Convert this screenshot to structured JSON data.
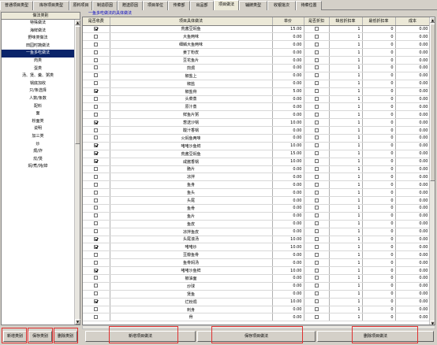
{
  "tabs": [
    {
      "label": "普通项目类型",
      "active": false
    },
    {
      "label": "库存项目类型",
      "active": false
    },
    {
      "label": "原料项目",
      "active": false
    },
    {
      "label": "制造原因",
      "active": false
    },
    {
      "label": "赠送原因",
      "active": false
    },
    {
      "label": "项目单位",
      "active": false
    },
    {
      "label": "传菜部",
      "active": false
    },
    {
      "label": "出品部",
      "active": false
    },
    {
      "label": "项目做法",
      "active": true
    },
    {
      "label": "辅牌类型",
      "active": false
    },
    {
      "label": "收银批次",
      "active": false
    },
    {
      "label": "待菜位置",
      "active": false
    }
  ],
  "left_panel": {
    "header": "做法类别",
    "items": [
      "特殊做法",
      "海鲜做法",
      "野味类做法",
      "田园时蔬做法",
      "一鱼多吃做法",
      "肉类",
      "蛋类",
      "汤、煲、羹、粥类",
      "锅底加收",
      "只/条选择",
      "人数/条数",
      "配料",
      "面",
      "粉面类",
      "说明",
      "加三类",
      "炒",
      "焗/炸",
      "炆/煲",
      "焖/煮/炖/焯"
    ],
    "selected_index": 4
  },
  "right_panel": {
    "caption": "一鱼多吃做法的具体做法",
    "columns": [
      "是否收费",
      "项目具体做法",
      "单价",
      "是否折扣",
      "缺省折扣率",
      "最低折扣率",
      "成本"
    ],
    "rows": [
      {
        "charge": true,
        "name": "荒酱豆焖鱼",
        "price": "15.00",
        "discount": false,
        "default_rate": "1",
        "min_rate": "0",
        "cost": "0.00"
      },
      {
        "charge": false,
        "name": "大鱼两味",
        "price": "0.00",
        "discount": false,
        "default_rate": "1",
        "min_rate": "0",
        "cost": "0.00"
      },
      {
        "charge": false,
        "name": "细鳞大鱼两味",
        "price": "0.00",
        "discount": false,
        "default_rate": "1",
        "min_rate": "0",
        "cost": "0.00"
      },
      {
        "charge": false,
        "name": "姜丁粉皮",
        "price": "0.00",
        "discount": false,
        "default_rate": "1",
        "min_rate": "0",
        "cost": "0.00"
      },
      {
        "charge": false,
        "name": "豆花鱼片",
        "price": "0.00",
        "discount": false,
        "default_rate": "1",
        "min_rate": "0",
        "cost": "0.00"
      },
      {
        "charge": false,
        "name": "煎焗",
        "price": "0.00",
        "discount": false,
        "default_rate": "1",
        "min_rate": "0",
        "cost": "0.00"
      },
      {
        "charge": false,
        "name": "椒盐上",
        "price": "0.00",
        "discount": false,
        "default_rate": "1",
        "min_rate": "0",
        "cost": "0.00"
      },
      {
        "charge": false,
        "name": "椒盐",
        "price": "0.00",
        "discount": false,
        "default_rate": "1",
        "min_rate": "0",
        "cost": "0.00"
      },
      {
        "charge": true,
        "name": "椒盐骨",
        "price": "5.00",
        "discount": false,
        "default_rate": "1",
        "min_rate": "0",
        "cost": "0.00"
      },
      {
        "charge": false,
        "name": "头菜蒸",
        "price": "0.00",
        "discount": false,
        "default_rate": "1",
        "min_rate": "0",
        "cost": "0.00"
      },
      {
        "charge": false,
        "name": "原汁蒸",
        "price": "0.00",
        "discount": false,
        "default_rate": "1",
        "min_rate": "0",
        "cost": "0.00"
      },
      {
        "charge": false,
        "name": "鲜鱼片粥",
        "price": "0.00",
        "discount": false,
        "default_rate": "1",
        "min_rate": "0",
        "cost": "0.00"
      },
      {
        "charge": true,
        "name": "葱送沙锅",
        "price": "10.00",
        "discount": false,
        "default_rate": "1",
        "min_rate": "0",
        "cost": "0.00"
      },
      {
        "charge": false,
        "name": "酸汁香锅",
        "price": "0.00",
        "discount": false,
        "default_rate": "1",
        "min_rate": "0",
        "cost": "0.00"
      },
      {
        "charge": false,
        "name": "火焖鱼两味",
        "price": "0.00",
        "discount": false,
        "default_rate": "1",
        "min_rate": "0",
        "cost": "0.00"
      },
      {
        "charge": true,
        "name": "啫啫沙鱼鲜",
        "price": "10.00",
        "discount": false,
        "default_rate": "1",
        "min_rate": "0",
        "cost": "0.00"
      },
      {
        "charge": true,
        "name": "荒酱豆焖鱼",
        "price": "15.00",
        "discount": false,
        "default_rate": "1",
        "min_rate": "0",
        "cost": "0.00"
      },
      {
        "charge": true,
        "name": "咸酱香锅",
        "price": "10.00",
        "discount": false,
        "default_rate": "1",
        "min_rate": "0",
        "cost": "0.00"
      },
      {
        "charge": false,
        "name": "脆片",
        "price": "0.00",
        "discount": false,
        "default_rate": "1",
        "min_rate": "0",
        "cost": "0.00"
      },
      {
        "charge": false,
        "name": "凉拌",
        "price": "0.00",
        "discount": false,
        "default_rate": "1",
        "min_rate": "0",
        "cost": "0.00"
      },
      {
        "charge": false,
        "name": "鱼身",
        "price": "0.00",
        "discount": false,
        "default_rate": "1",
        "min_rate": "0",
        "cost": "0.00"
      },
      {
        "charge": false,
        "name": "鱼头",
        "price": "0.00",
        "discount": false,
        "default_rate": "1",
        "min_rate": "0",
        "cost": "0.00"
      },
      {
        "charge": false,
        "name": "头尾",
        "price": "0.00",
        "discount": false,
        "default_rate": "1",
        "min_rate": "0",
        "cost": "0.00"
      },
      {
        "charge": false,
        "name": "鱼骨",
        "price": "0.00",
        "discount": false,
        "default_rate": "1",
        "min_rate": "0",
        "cost": "0.00"
      },
      {
        "charge": false,
        "name": "鱼片",
        "price": "0.00",
        "discount": false,
        "default_rate": "1",
        "min_rate": "0",
        "cost": "0.00"
      },
      {
        "charge": false,
        "name": "鱼皮",
        "price": "0.00",
        "discount": false,
        "default_rate": "1",
        "min_rate": "0",
        "cost": "0.00"
      },
      {
        "charge": false,
        "name": "凉拌鱼皮",
        "price": "0.00",
        "discount": false,
        "default_rate": "1",
        "min_rate": "0",
        "cost": "0.00"
      },
      {
        "charge": true,
        "name": "头尾滚汤",
        "price": "10.00",
        "discount": false,
        "default_rate": "1",
        "min_rate": "0",
        "cost": "0.00"
      },
      {
        "charge": true,
        "name": "啫啫炒",
        "price": "10.00",
        "discount": false,
        "default_rate": "1",
        "min_rate": "0",
        "cost": "0.00"
      },
      {
        "charge": false,
        "name": "豆瓣鱼骨",
        "price": "0.00",
        "discount": false,
        "default_rate": "1",
        "min_rate": "0",
        "cost": "0.00"
      },
      {
        "charge": false,
        "name": "鱼骨焖汤",
        "price": "0.00",
        "discount": false,
        "default_rate": "1",
        "min_rate": "0",
        "cost": "0.00"
      },
      {
        "charge": true,
        "name": "啫啫沙鱼鲜",
        "price": "10.00",
        "discount": false,
        "default_rate": "1",
        "min_rate": "0",
        "cost": "0.00"
      },
      {
        "charge": false,
        "name": "椒油面",
        "price": "0.00",
        "discount": false,
        "default_rate": "1",
        "min_rate": "0",
        "cost": "0.00"
      },
      {
        "charge": false,
        "name": "炒球",
        "price": "0.00",
        "discount": false,
        "default_rate": "1",
        "min_rate": "0",
        "cost": "0.00"
      },
      {
        "charge": false,
        "name": "煲鱼",
        "price": "0.00",
        "discount": false,
        "default_rate": "1",
        "min_rate": "0",
        "cost": "0.00"
      },
      {
        "charge": true,
        "name": "烂粉焗",
        "price": "10.00",
        "discount": false,
        "default_rate": "1",
        "min_rate": "0",
        "cost": "0.00"
      },
      {
        "charge": false,
        "name": "刺身",
        "price": "0.00",
        "discount": false,
        "default_rate": "1",
        "min_rate": "0",
        "cost": "0.00"
      },
      {
        "charge": false,
        "name": "骨",
        "price": "0.00",
        "discount": false,
        "default_rate": "1",
        "min_rate": "0",
        "cost": "0.00"
      }
    ]
  },
  "buttons": {
    "add_category": "新增类别",
    "save_category": "保存类别",
    "delete_category": "删除类别",
    "add_method": "新增项目做法",
    "save_method": "保存项目做法",
    "delete_method": "删除项目做法"
  },
  "colors": {
    "window_bg": "#d4d0c8",
    "selection": "#0a246a",
    "caption": "#0000c0",
    "highlight_outline": "#e03030"
  }
}
